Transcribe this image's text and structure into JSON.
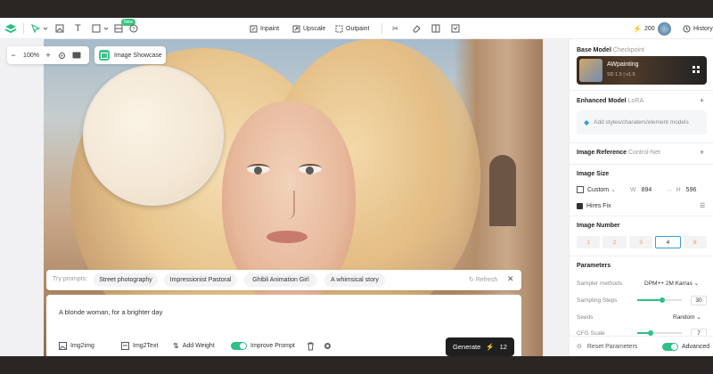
{
  "toolbar": {
    "new_badge": "New",
    "inpaint": "Inpaint",
    "upscale": "Upscale",
    "outpaint": "Outpaint",
    "credits": "200",
    "history": "History"
  },
  "canvas": {
    "zoom": "100%",
    "showcase_label": "Image Showcase"
  },
  "prompts": {
    "try_label": "Try prompts:",
    "chips": [
      "Street photography",
      "Impressionist Pastoral",
      "Ghibli Animation Girl",
      "A whimsical story"
    ],
    "refresh": "Refresh"
  },
  "editor": {
    "prompt_text": "A blonde woman, for a brighter day",
    "img2img": "Img2img",
    "img2text": "Img2Text",
    "add_weight": "Add Weight",
    "improve_prompt": "Improve Prompt",
    "generate": "Generate",
    "generate_cost": "12"
  },
  "sidebar": {
    "base_model": {
      "title": "Base Model",
      "sub": "Checkpoint",
      "name": "AWpainting",
      "version": "SD 1.5 | v1.5"
    },
    "enhanced_model": {
      "title": "Enhanced Model",
      "sub": "LoRA",
      "placeholder": "Add styles/charaters/element models"
    },
    "image_reference": {
      "title": "Image Reference",
      "sub": "Control-Net"
    },
    "image_size": {
      "title": "Image Size",
      "preset": "Custom",
      "w_label": "W",
      "w": "894",
      "h_label": "H",
      "h": "596",
      "hires": "Hires Fix"
    },
    "image_number": {
      "title": "Image Number",
      "options": [
        "1",
        "2",
        "3",
        "4",
        "8"
      ],
      "selected": "4"
    },
    "parameters": {
      "title": "Parameters",
      "sampler_label": "Sampler methods",
      "sampler_value": "DPM++ 2M Karras",
      "steps_label": "Sampling Steps",
      "steps_value": "30",
      "steps_fraction": 0.55,
      "seeds_label": "Seeds",
      "seeds_value": "Random",
      "cfg_label": "CFG Scale",
      "cfg_value": "7",
      "cfg_fraction": 0.3
    },
    "footer": {
      "reset": "Reset Parameters",
      "advanced": "Advanced"
    }
  }
}
